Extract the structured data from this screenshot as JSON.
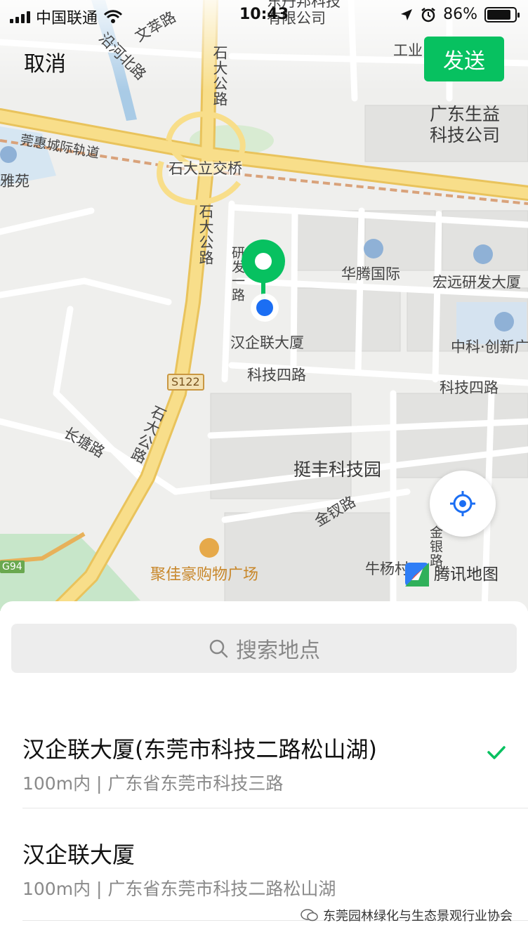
{
  "status_bar": {
    "carrier": "中国联通",
    "time": "10:43",
    "battery": "86%",
    "battery_level": 0.86
  },
  "nav": {
    "cancel_label": "取消",
    "send_label": "发送"
  },
  "map": {
    "labels": {
      "wencui_road": "文萃路",
      "yanhe_north_road": "沿河北路",
      "shida_road_1": "石大公路",
      "shida_road_2": "石大公路",
      "shida_road_3": "石大公路",
      "shida_road_4": "石大公路",
      "guanhui_rail": "莞惠城际轨道",
      "shidali_bridge": "石大立交桥",
      "yayuan": "雅苑",
      "guangdong_shengyi": "广东生益\n科技公司",
      "industrial": "工业",
      "dongfang_tech": "东丹邦科技\n有限公司",
      "yanfa_road": "研发一路",
      "huateng": "华腾国际",
      "hongyuan": "宏远研发大厦",
      "hanqilian": "汉企联大厦",
      "zhongke": "中科·创新广",
      "keji_4_a": "科技四路",
      "keji_4_b": "科技四路",
      "s122": "S122",
      "changtang_road": "长塘路",
      "tingfeng_park": "挺丰科技园",
      "jinchai_road": "金钗路",
      "jinyin_road": "金银路",
      "juhua_mall": "聚佳豪购物广场",
      "niuyang": "牛杨村",
      "g94": "G94",
      "tencent_map": "腾讯地图"
    }
  },
  "search": {
    "placeholder": "搜索地点"
  },
  "results": [
    {
      "title": "汉企联大厦(东莞市科技二路松山湖)",
      "subtitle": "100m内 | 广东省东莞市科技三路",
      "selected": true
    },
    {
      "title": "汉企联大厦",
      "subtitle": "100m内 | 广东省东莞市科技二路松山湖",
      "selected": false
    }
  ],
  "watermark": "东莞园林绿化与生态景观行业协会",
  "colors": {
    "accent": "#07c160",
    "road_major": "#f5d77f",
    "pin_blue": "#1b6ef3"
  }
}
